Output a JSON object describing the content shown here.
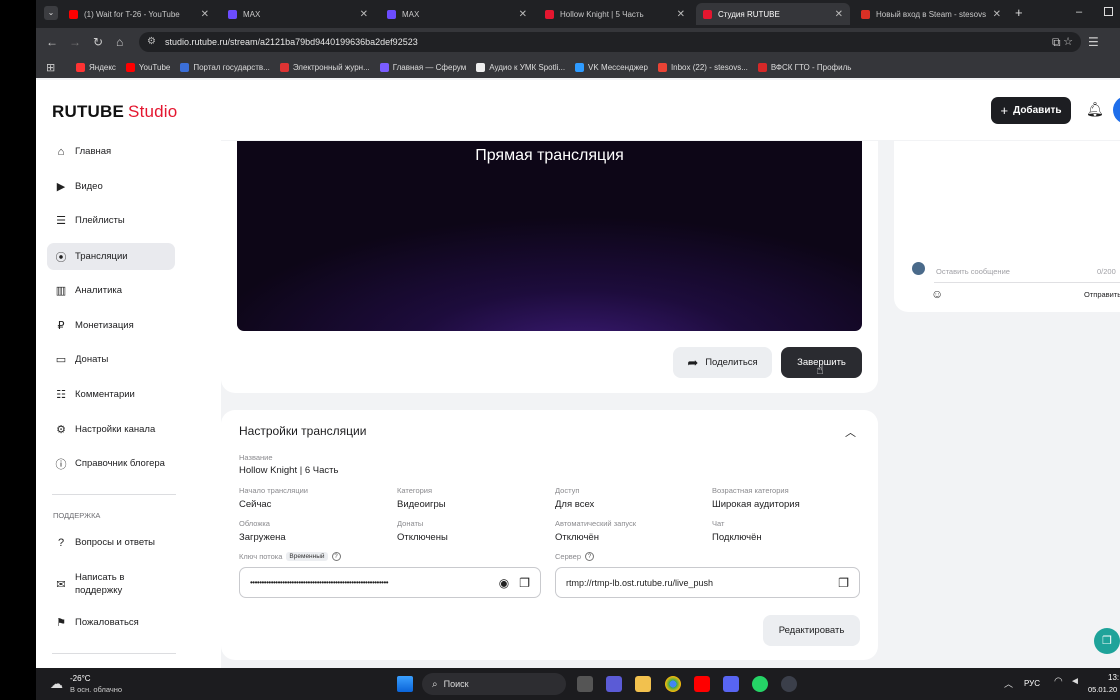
{
  "browser": {
    "tabs": [
      {
        "title": "(1) Wait for T-26 - YouTube",
        "color": "#ff0000"
      },
      {
        "title": "MAX",
        "color": "#6b4cff"
      },
      {
        "title": "MAX",
        "color": "#6b4cff"
      },
      {
        "title": "Hollow Knight | 5 Часть",
        "color": "#e4162f"
      },
      {
        "title": "Студия RUTUBE",
        "color": "#e4162f"
      },
      {
        "title": "Новый вход в Steam - stesovs",
        "color": "#d93025"
      }
    ],
    "url": "studio.rutube.ru/stream/a2121ba79bd9440199636ba2def92523",
    "bookmarks": [
      {
        "label": "Яндекс",
        "color": "#ff3333"
      },
      {
        "label": "YouTube",
        "color": "#ff0000"
      },
      {
        "label": "Портал государств...",
        "color": "#3b6fd8"
      },
      {
        "label": "Электронный журн...",
        "color": "#d33"
      },
      {
        "label": "Главная — Сферум",
        "color": "#7a5cff"
      },
      {
        "label": "Аудио к УМК Spotli...",
        "color": "#eee"
      },
      {
        "label": "VK Мессенджер",
        "color": "#2e9bff"
      },
      {
        "label": "Inbox (22) - stesovs...",
        "color": "#ea4335"
      },
      {
        "label": "ВФСК ГТО - Профиль",
        "color": "#d62828"
      }
    ]
  },
  "app": {
    "logo_main": "RUTUBE",
    "logo_sub": "Studio",
    "add_button": "Добавить"
  },
  "sidebar": {
    "items": [
      {
        "label": "Главная",
        "icon": "home-icon"
      },
      {
        "label": "Видео",
        "icon": "video-icon"
      },
      {
        "label": "Плейлисты",
        "icon": "playlist-icon"
      },
      {
        "label": "Трансляции",
        "icon": "broadcast-icon"
      },
      {
        "label": "Аналитика",
        "icon": "analytics-icon"
      },
      {
        "label": "Монетизация",
        "icon": "ruble-icon"
      },
      {
        "label": "Донаты",
        "icon": "donate-icon"
      },
      {
        "label": "Комментарии",
        "icon": "comment-icon"
      },
      {
        "label": "Настройки канала",
        "icon": "gear-icon"
      },
      {
        "label": "Справочник блогера",
        "icon": "info-icon"
      }
    ],
    "support_title": "ПОДДЕРЖКА",
    "support_items": [
      {
        "label": "Вопросы и ответы"
      },
      {
        "label": "Написать в поддержку"
      },
      {
        "label": "Пожаловаться"
      }
    ]
  },
  "stream": {
    "video_title": "Прямая трансляция",
    "share_button": "Поделиться",
    "finish_button": "Завершить"
  },
  "chat": {
    "placeholder": "Оставить сообщение",
    "counter": "0/200",
    "send": "Отправить"
  },
  "settings": {
    "title": "Настройки трансляции",
    "name_label": "Название",
    "name_value": "Hollow Knight | 6 Часть",
    "fields": [
      {
        "label": "Начало трансляции",
        "value": "Сейчас"
      },
      {
        "label": "Категория",
        "value": "Видеоигры"
      },
      {
        "label": "Доступ",
        "value": "Для всех"
      },
      {
        "label": "Возрастная категория",
        "value": "Широкая аудитория"
      },
      {
        "label": "Обложка",
        "value": "Загружена"
      },
      {
        "label": "Донаты",
        "value": "Отключены"
      },
      {
        "label": "Автоматический запуск",
        "value": "Отключён"
      },
      {
        "label": "Чат",
        "value": "Подключён"
      }
    ],
    "key_label": "Ключ потока",
    "key_badge": "Временный",
    "key_value": "••••••••••••••••••••••••••••••••••••••••••••••••••••••••••••",
    "server_label": "Сервер",
    "server_value": "rtmp://rtmp-lb.ost.rutube.ru/live_push",
    "edit_button": "Редактировать"
  },
  "taskbar": {
    "weather_temp": "-26°C",
    "weather_desc": "В осн. облачно",
    "search": "Поиск",
    "lang": "РУС",
    "time": "13:",
    "date": "05.01.20"
  }
}
